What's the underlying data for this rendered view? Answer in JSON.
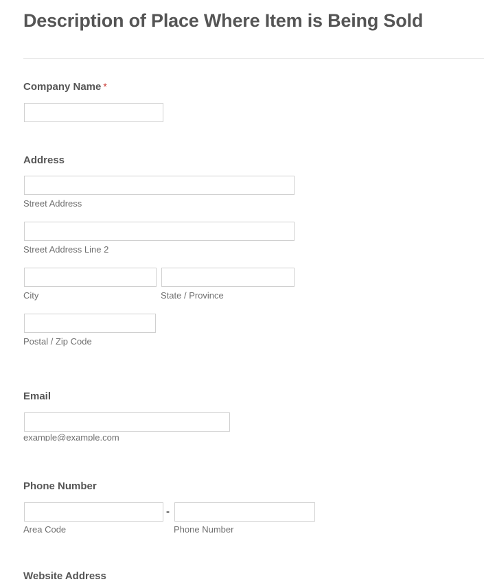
{
  "page": {
    "title": "Description of Place Where Item is Being Sold",
    "background_color": "#ffffff",
    "label_color": "#555555",
    "sublabel_color": "#6f6f6f",
    "required_marker_color": "#c9332e",
    "input_border_color": "#d0d0d0",
    "divider_color": "#e6e6e6"
  },
  "fields": {
    "company": {
      "label": "Company Name",
      "required_marker": "*",
      "value": "",
      "placeholder": ""
    },
    "address": {
      "label": "Address",
      "street1": {
        "sublabel": "Street Address",
        "value": "",
        "placeholder": ""
      },
      "street2": {
        "sublabel": "Street Address Line 2",
        "value": "",
        "placeholder": ""
      },
      "city": {
        "sublabel": "City",
        "value": "",
        "placeholder": ""
      },
      "state": {
        "sublabel": "State / Province",
        "value": "",
        "placeholder": ""
      },
      "postal": {
        "sublabel": "Postal / Zip Code",
        "value": "",
        "placeholder": ""
      }
    },
    "email": {
      "label": "Email",
      "sublabel": "example@example.com",
      "value": "",
      "placeholder": ""
    },
    "phone": {
      "label": "Phone Number",
      "separator": "-",
      "area_code": {
        "sublabel": "Area Code",
        "value": "",
        "placeholder": ""
      },
      "number": {
        "sublabel": "Phone Number",
        "value": "",
        "placeholder": ""
      }
    },
    "website": {
      "label": "Website Address"
    }
  }
}
